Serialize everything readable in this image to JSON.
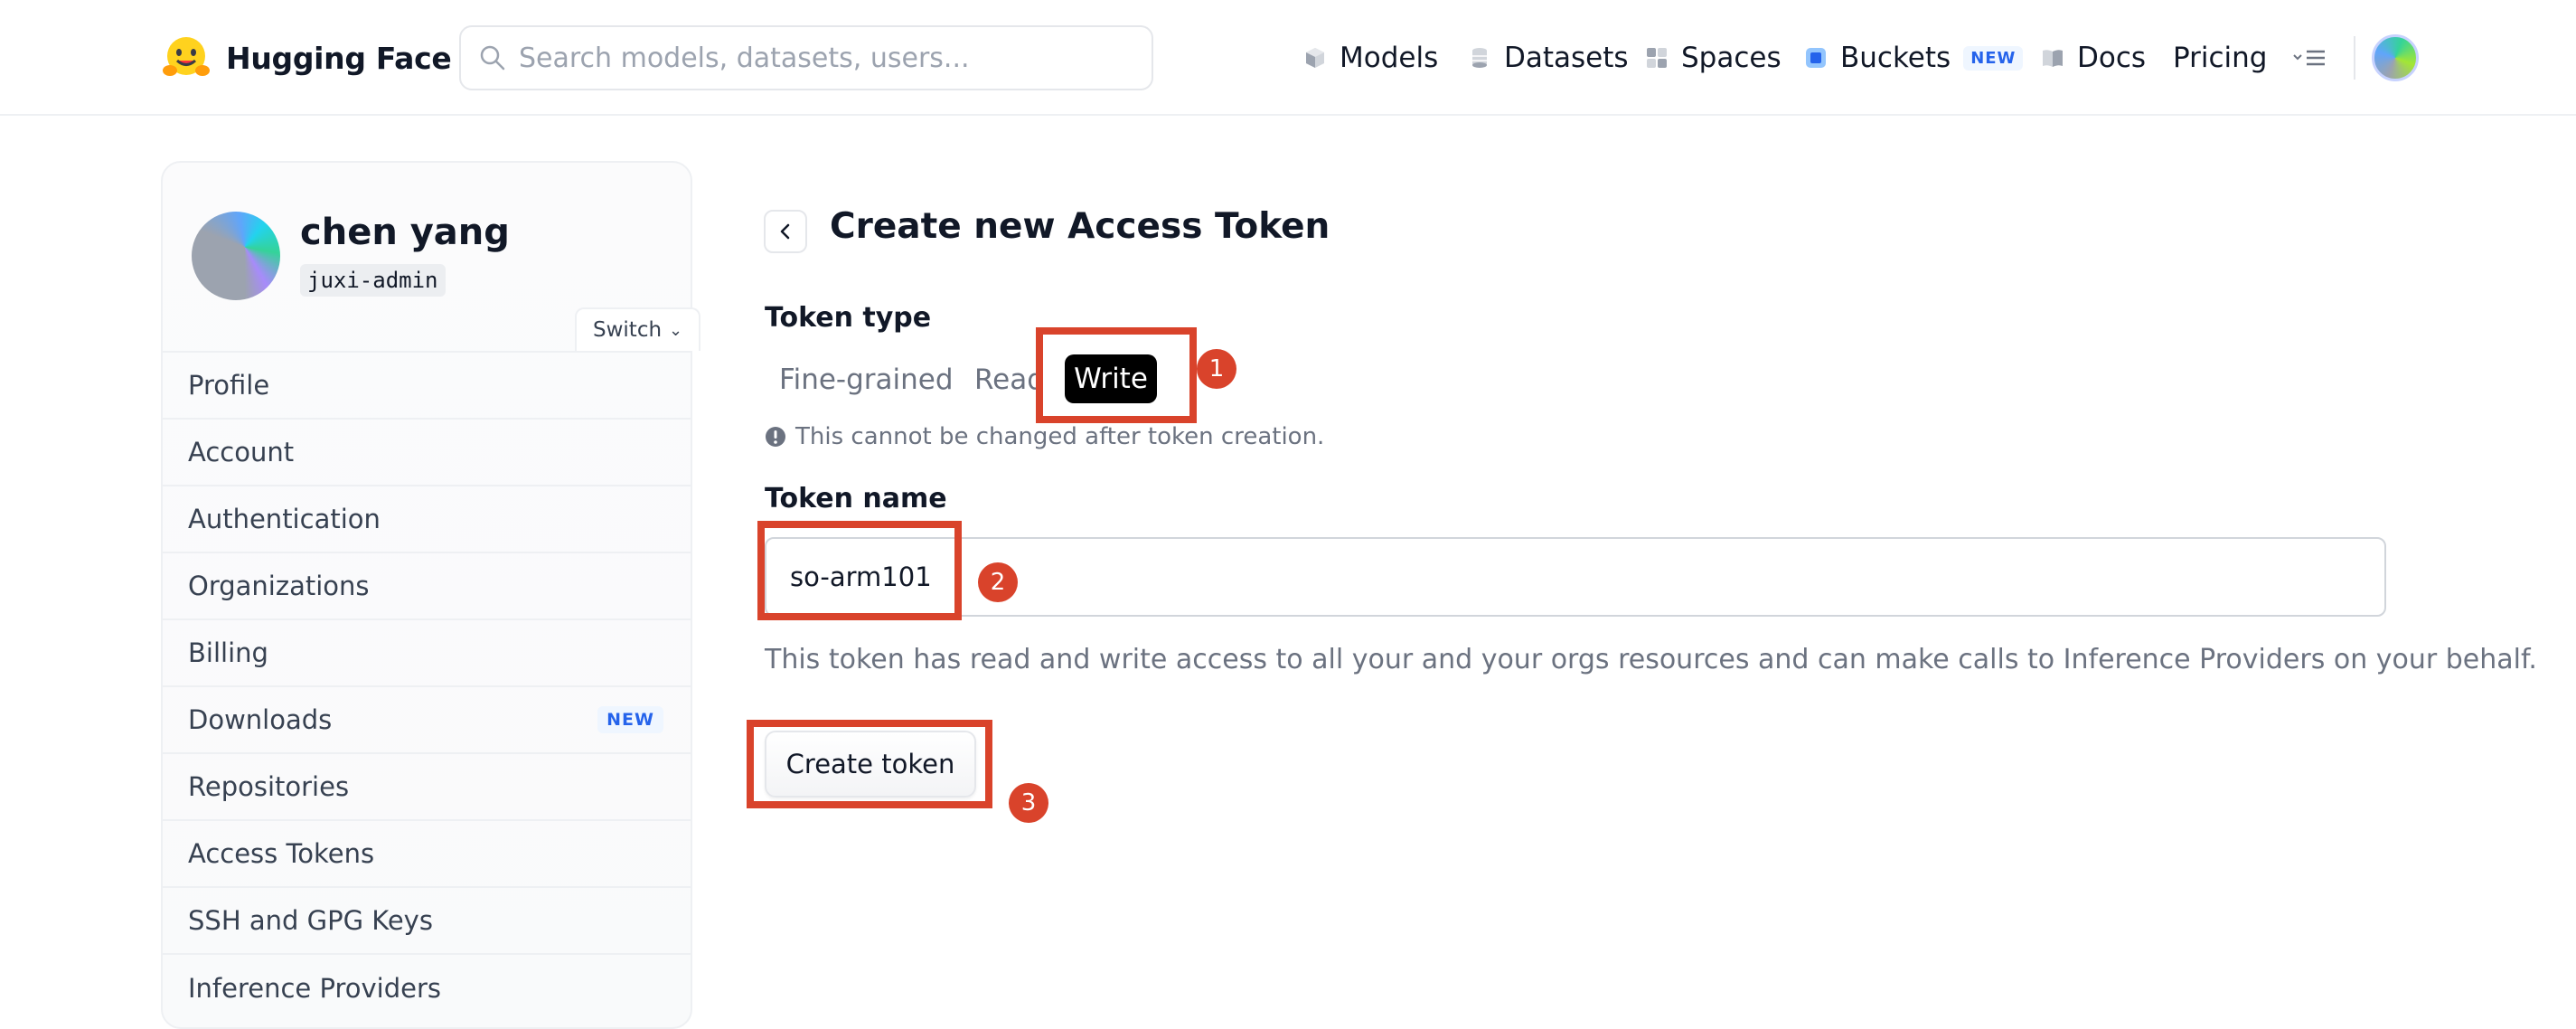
{
  "brand": {
    "name": "Hugging Face"
  },
  "search": {
    "placeholder": "Search models, datasets, users..."
  },
  "nav": {
    "items": [
      {
        "label": "Models",
        "icon": "cube-icon"
      },
      {
        "label": "Datasets",
        "icon": "database-icon"
      },
      {
        "label": "Spaces",
        "icon": "spaces-icon"
      },
      {
        "label": "Buckets",
        "icon": "bucket-icon",
        "badge": "NEW"
      },
      {
        "label": "Docs",
        "icon": "book-icon"
      },
      {
        "label": "Pricing"
      }
    ]
  },
  "sidebar": {
    "user_name": "chen yang",
    "user_handle": "juxi-admin",
    "switch_label": "Switch",
    "items": [
      {
        "label": "Profile"
      },
      {
        "label": "Account"
      },
      {
        "label": "Authentication"
      },
      {
        "label": "Organizations"
      },
      {
        "label": "Billing"
      },
      {
        "label": "Downloads",
        "badge": "NEW"
      },
      {
        "label": "Repositories"
      },
      {
        "label": "Access Tokens"
      },
      {
        "label": "SSH and GPG Keys"
      },
      {
        "label": "Inference Providers"
      }
    ]
  },
  "main": {
    "title": "Create new Access Token",
    "token_type_label": "Token type",
    "token_types": [
      "Fine-grained",
      "Read",
      "Write"
    ],
    "selected_token_type": "Write",
    "note": "This cannot be changed after token creation.",
    "token_name_label": "Token name",
    "token_name_value": "so-arm101",
    "description": "This token has read and write access to all your and your orgs resources and can make calls to Inference Providers on your behalf.",
    "create_button": "Create token"
  },
  "annotations": {
    "steps": [
      "1",
      "2",
      "3"
    ],
    "color": "#d9432b"
  }
}
